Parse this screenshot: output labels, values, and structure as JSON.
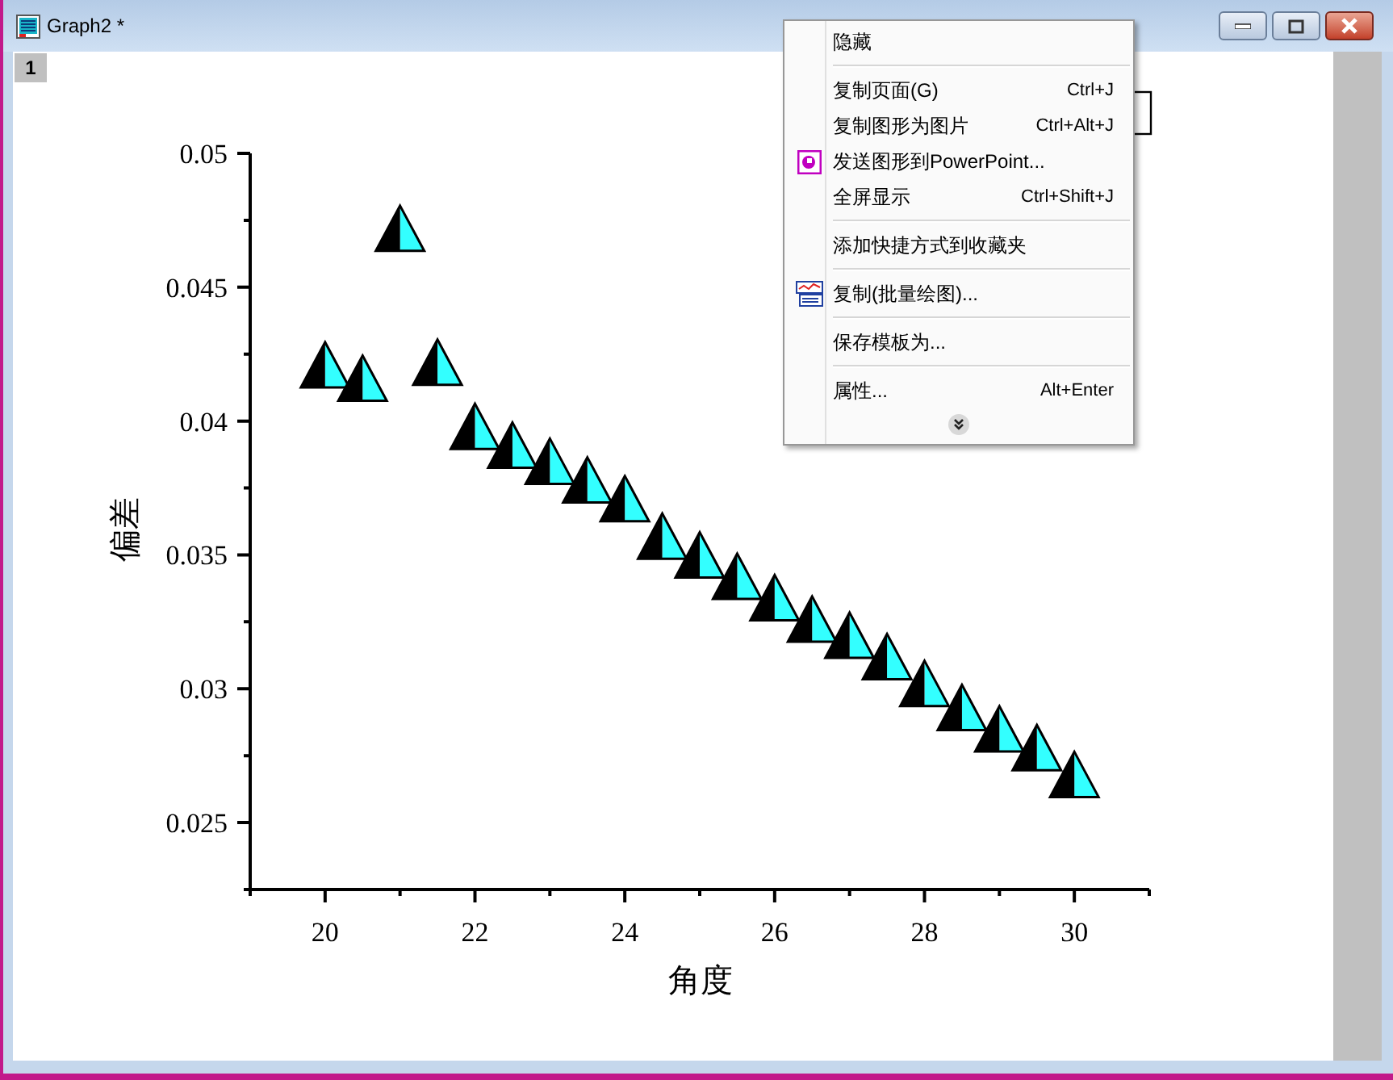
{
  "window": {
    "title": "Graph2 *"
  },
  "layer_tag": "1",
  "chart": {
    "chart_data": {
      "type": "scatter",
      "xlabel": "角度",
      "ylabel": "偏差",
      "xlim": [
        19,
        31
      ],
      "ylim": [
        0.0225,
        0.05
      ],
      "xticks": [
        {
          "value": 20,
          "label": "20"
        },
        {
          "value": 22,
          "label": "22"
        },
        {
          "value": 24,
          "label": "24"
        },
        {
          "value": 26,
          "label": "26"
        },
        {
          "value": 28,
          "label": "28"
        },
        {
          "value": 30,
          "label": "30"
        }
      ],
      "yticks": [
        {
          "value": 0.025,
          "label": "0.025"
        },
        {
          "value": 0.03,
          "label": "0.03"
        },
        {
          "value": 0.035,
          "label": "0.035"
        },
        {
          "value": 0.04,
          "label": "0.04"
        },
        {
          "value": 0.045,
          "label": "0.045"
        },
        {
          "value": 0.05,
          "label": "0.05"
        }
      ],
      "x": [
        20,
        20.5,
        21,
        21.5,
        22,
        22.5,
        23,
        23.5,
        24,
        24.5,
        25,
        25.5,
        26,
        26.5,
        27,
        27.5,
        28,
        28.5,
        29,
        29.5,
        30
      ],
      "series": [
        {
          "values": [
            0.0421,
            0.0416,
            0.0472,
            0.0422,
            0.0398,
            0.0391,
            0.0385,
            0.0378,
            0.0371,
            0.0357,
            0.035,
            0.0342,
            0.0334,
            0.0326,
            0.032,
            0.0312,
            0.0302,
            0.0293,
            0.0285,
            0.0278,
            0.0268
          ]
        }
      ]
    }
  },
  "context_menu": {
    "items": [
      {
        "kind": "plain",
        "label": "隐藏"
      },
      {
        "kind": "separator"
      },
      {
        "kind": "plain",
        "label": "复制页面(G)",
        "shortcut": "Ctrl+J"
      },
      {
        "kind": "plain",
        "label": "复制图形为图片",
        "shortcut": "Ctrl+Alt+J"
      },
      {
        "kind": "slide",
        "label": "发送图形到PowerPoint..."
      },
      {
        "kind": "plain",
        "label": "全屏显示",
        "shortcut": "Ctrl+Shift+J"
      },
      {
        "kind": "separator"
      },
      {
        "kind": "plain",
        "label": "添加快捷方式到收藏夹"
      },
      {
        "kind": "separator"
      },
      {
        "kind": "batch",
        "label": "复制(批量绘图)..."
      },
      {
        "kind": "separator"
      },
      {
        "kind": "plain",
        "label": "保存模板为..."
      },
      {
        "kind": "separator"
      },
      {
        "kind": "plain",
        "label": "属性...",
        "shortcut": "Alt+Enter"
      }
    ]
  }
}
